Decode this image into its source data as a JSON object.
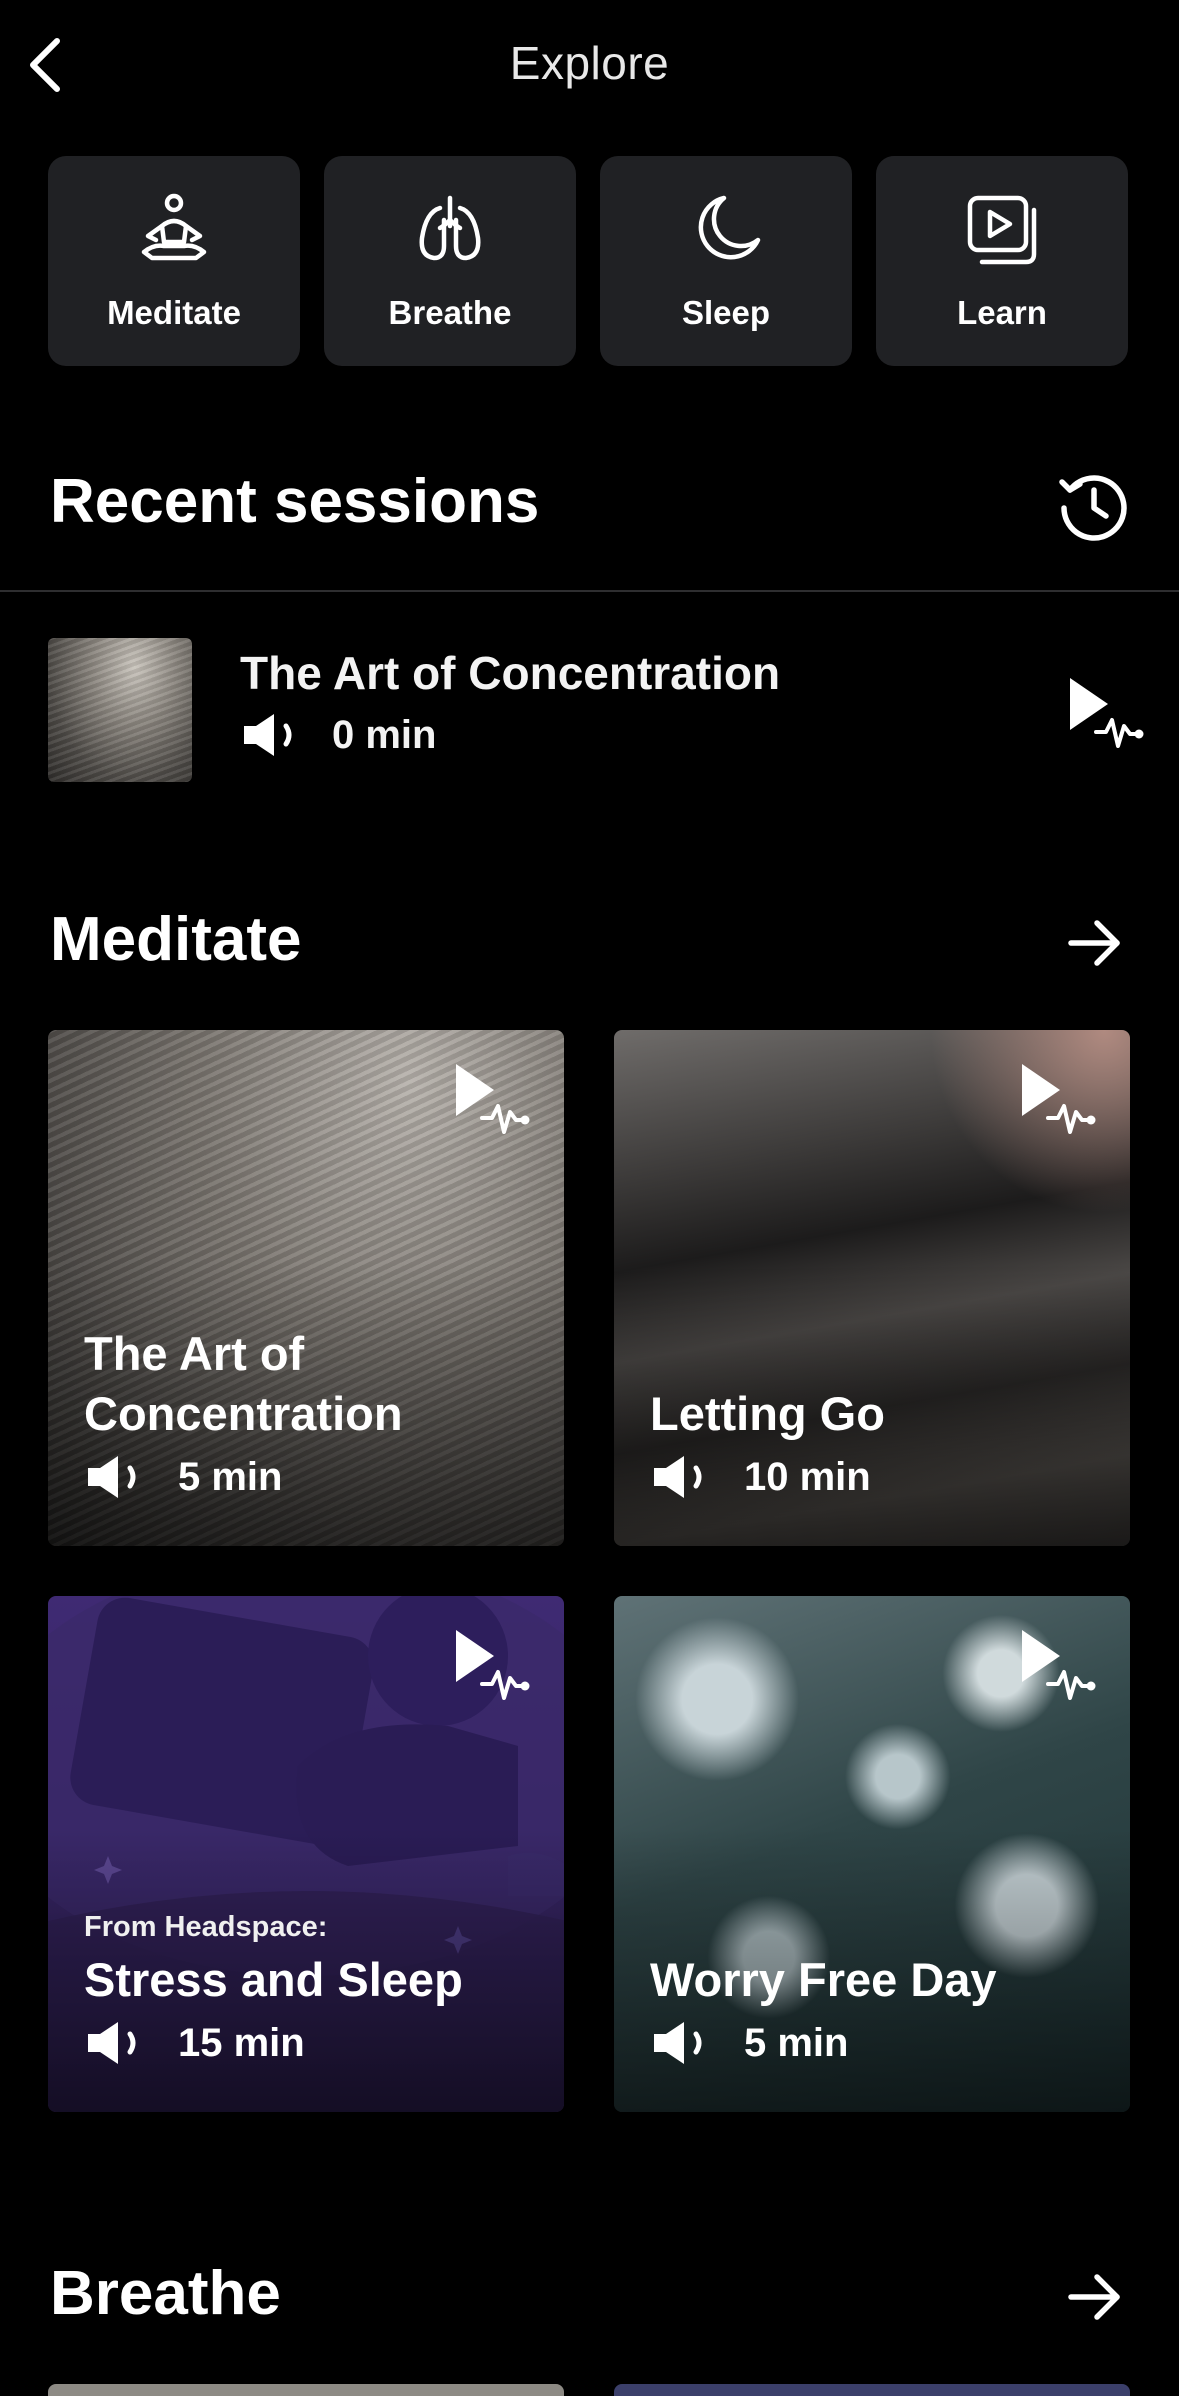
{
  "header": {
    "title": "Explore",
    "back_icon": "chevron-left-icon"
  },
  "categories": [
    {
      "label": "Meditate",
      "icon": "meditate-icon"
    },
    {
      "label": "Breathe",
      "icon": "lungs-icon"
    },
    {
      "label": "Sleep",
      "icon": "moon-icon"
    },
    {
      "label": "Learn",
      "icon": "play-square-icon"
    }
  ],
  "recent": {
    "title": "Recent sessions",
    "icon": "history-icon",
    "items": [
      {
        "title": "The Art of Concentration",
        "duration": "0 min",
        "type_icon": "speaker-icon"
      }
    ]
  },
  "meditate": {
    "title": "Meditate",
    "icon": "arrow-right-icon",
    "cards": [
      {
        "title": "The Art of Concentration",
        "duration": "5 min"
      },
      {
        "title": "Letting Go",
        "duration": "10 min"
      },
      {
        "pre_title": "From Headspace:",
        "title": "Stress and Sleep",
        "duration": "15 min"
      },
      {
        "title": "Worry Free Day",
        "duration": "5 min"
      }
    ]
  },
  "breathe": {
    "title": "Breathe",
    "icon": "arrow-right-icon"
  }
}
